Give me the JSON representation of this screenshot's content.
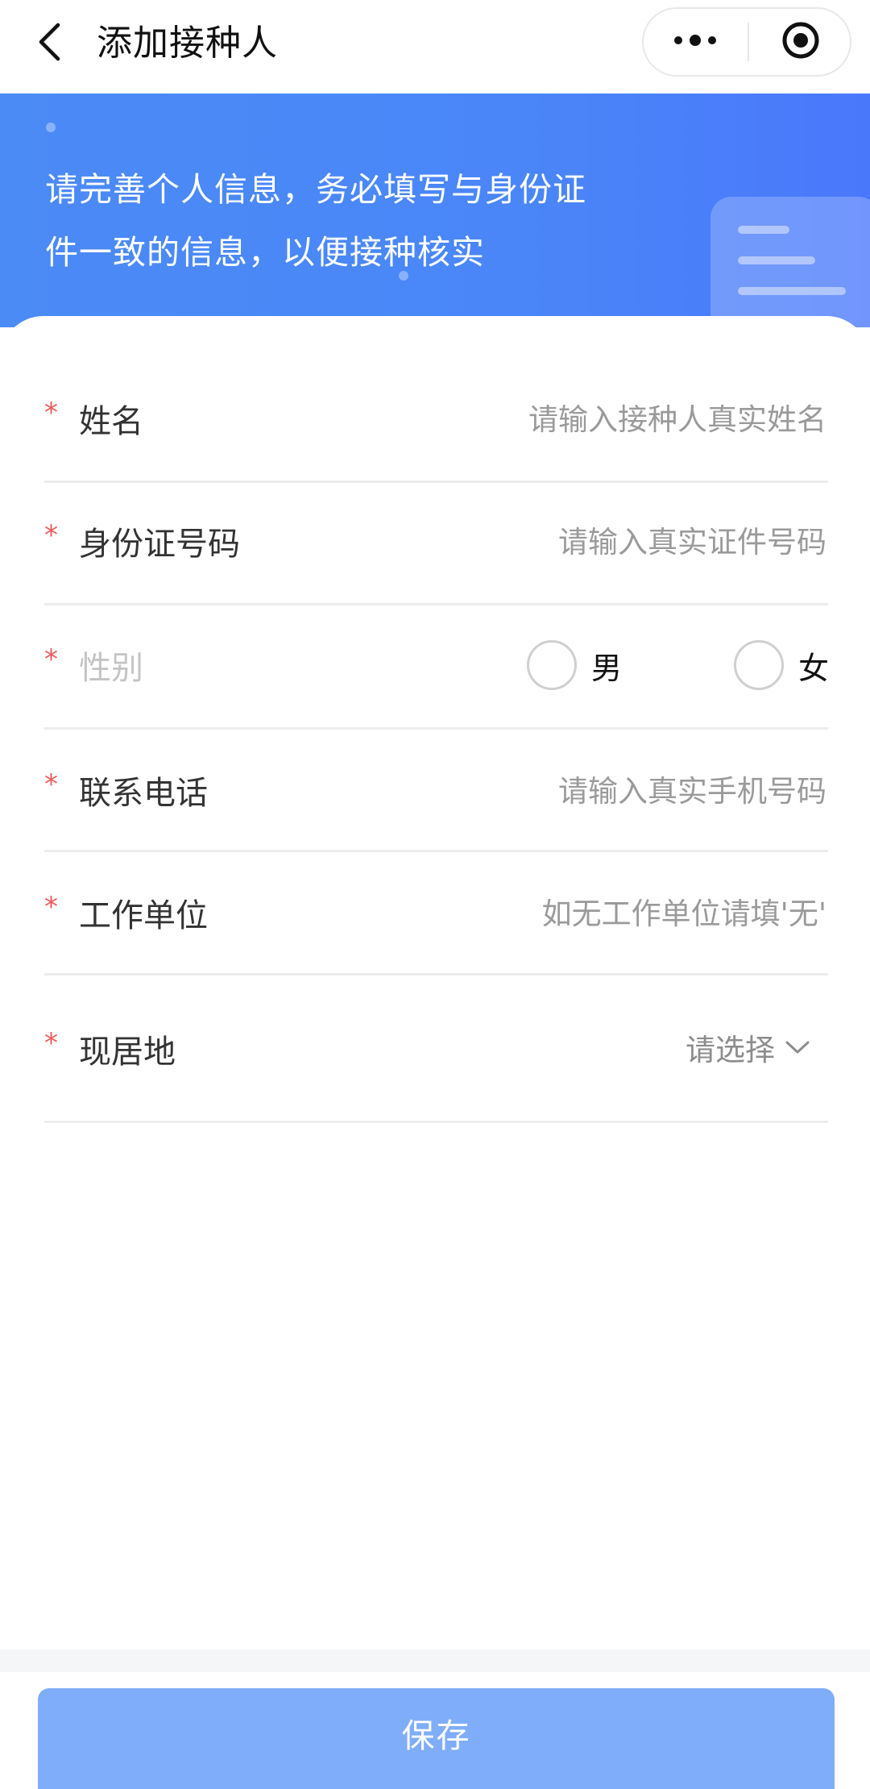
{
  "navbar": {
    "title": "添加接种人",
    "back_icon": "chevron-left-icon",
    "more_icon": "more-dots-icon",
    "close_icon": "target-close-icon"
  },
  "banner": {
    "line1": "请完善个人信息，务必填写与身份证",
    "line2": "件一致的信息，以便接种核实",
    "background": "#4a86f8"
  },
  "form": {
    "required_mark": "*",
    "name": {
      "label": "姓名",
      "placeholder": "请输入接种人真实姓名",
      "value": ""
    },
    "id_number": {
      "label": "身份证号码",
      "placeholder": "请输入真实证件号码",
      "value": ""
    },
    "gender": {
      "label": "性别",
      "options": [
        "男",
        "女"
      ],
      "selected": null
    },
    "phone": {
      "label": "联系电话",
      "placeholder": "请输入真实手机号码",
      "value": ""
    },
    "employer": {
      "label": "工作单位",
      "placeholder": "如无工作单位请填'无'",
      "value": ""
    },
    "residence": {
      "label": "现居地",
      "select_text": "请选择"
    }
  },
  "footer": {
    "save_label": "保存",
    "button_color": "#7fadf9"
  },
  "colors": {
    "required": "#ee5a5a",
    "label": "#333333",
    "placeholder": "#9a9a9a",
    "divider": "#ececec"
  }
}
